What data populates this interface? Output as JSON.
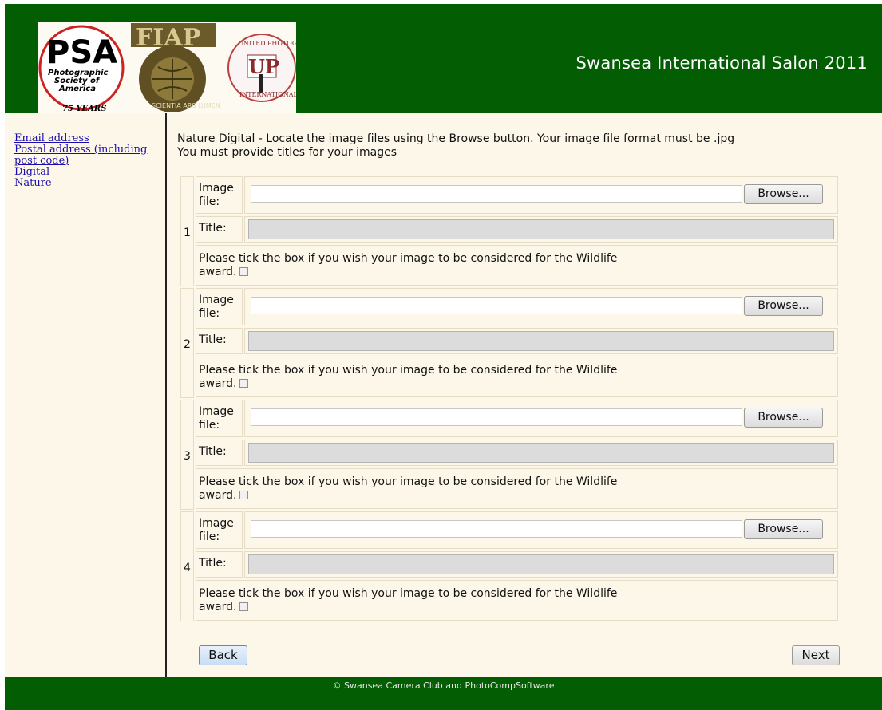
{
  "header": {
    "title": "Swansea International Salon 2011",
    "logos": [
      {
        "icon": "psa-logo",
        "text": [
          "PSA",
          "Photographic",
          "Society of",
          "America",
          "75 YEARS"
        ]
      },
      {
        "icon": "fiap-logo",
        "text": [
          "FIAP",
          "SCIENTIA ARS LUMEN"
        ]
      },
      {
        "icon": "up-logo",
        "text": [
          "UNITED PHOTOGRAPHERS",
          "UP",
          "INTERNATIONAL"
        ]
      }
    ]
  },
  "sidebar": {
    "links": [
      {
        "label": "Email address"
      },
      {
        "label": "Postal address (including post code)"
      },
      {
        "label": "Digital"
      },
      {
        "label": "Nature"
      }
    ]
  },
  "main": {
    "instructions": [
      "Nature Digital - Locate the image files using the Browse button. Your image file format must be .jpg",
      "You must provide titles for your images"
    ],
    "entries": [
      {
        "number": "1",
        "image_label": "Image file:",
        "browse_label": "Browse...",
        "title_label": "Title:",
        "wildlife_text": "Please tick the box if you wish your image to be considered for the Wildlife award."
      },
      {
        "number": "2",
        "image_label": "Image file:",
        "browse_label": "Browse...",
        "title_label": "Title:",
        "wildlife_text": "Please tick the box if you wish your image to be considered for the Wildlife award."
      },
      {
        "number": "3",
        "image_label": "Image file:",
        "browse_label": "Browse...",
        "title_label": "Title:",
        "wildlife_text": "Please tick the box if you wish your image to be considered for the Wildlife award."
      },
      {
        "number": "4",
        "image_label": "Image file:",
        "browse_label": "Browse...",
        "title_label": "Title:",
        "wildlife_text": "Please tick the box if you wish your image to be considered for the Wildlife award."
      }
    ],
    "back_label": "Back",
    "next_label": "Next"
  },
  "footer": {
    "text": "© Swansea Camera Club  and PhotoCompSoftware"
  },
  "colors": {
    "header_green": "#035e03",
    "panel_cream": "#fdf7e9",
    "link_blue": "#1a0dab"
  }
}
